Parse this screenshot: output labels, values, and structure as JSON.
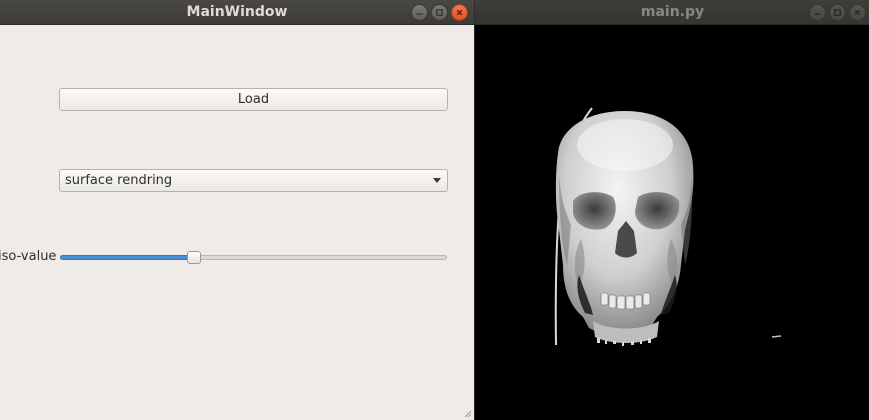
{
  "main_window": {
    "title": "MainWindow",
    "load_label": "Load",
    "render_mode": {
      "selected": "surface rendring"
    },
    "iso_label": "iso-value",
    "iso_slider": {
      "value_fraction": 0.34
    }
  },
  "render_window": {
    "title": "main.py"
  },
  "colors": {
    "titlebar": "#3c3b37",
    "window_bg": "#efebe7",
    "close": "#e95420",
    "slider_fill": "#4a90d9",
    "render_bg": "#000000"
  },
  "icons": [
    "minimize-icon",
    "maximize-icon",
    "close-icon",
    "chevron-down-icon",
    "resize-grip-icon"
  ]
}
